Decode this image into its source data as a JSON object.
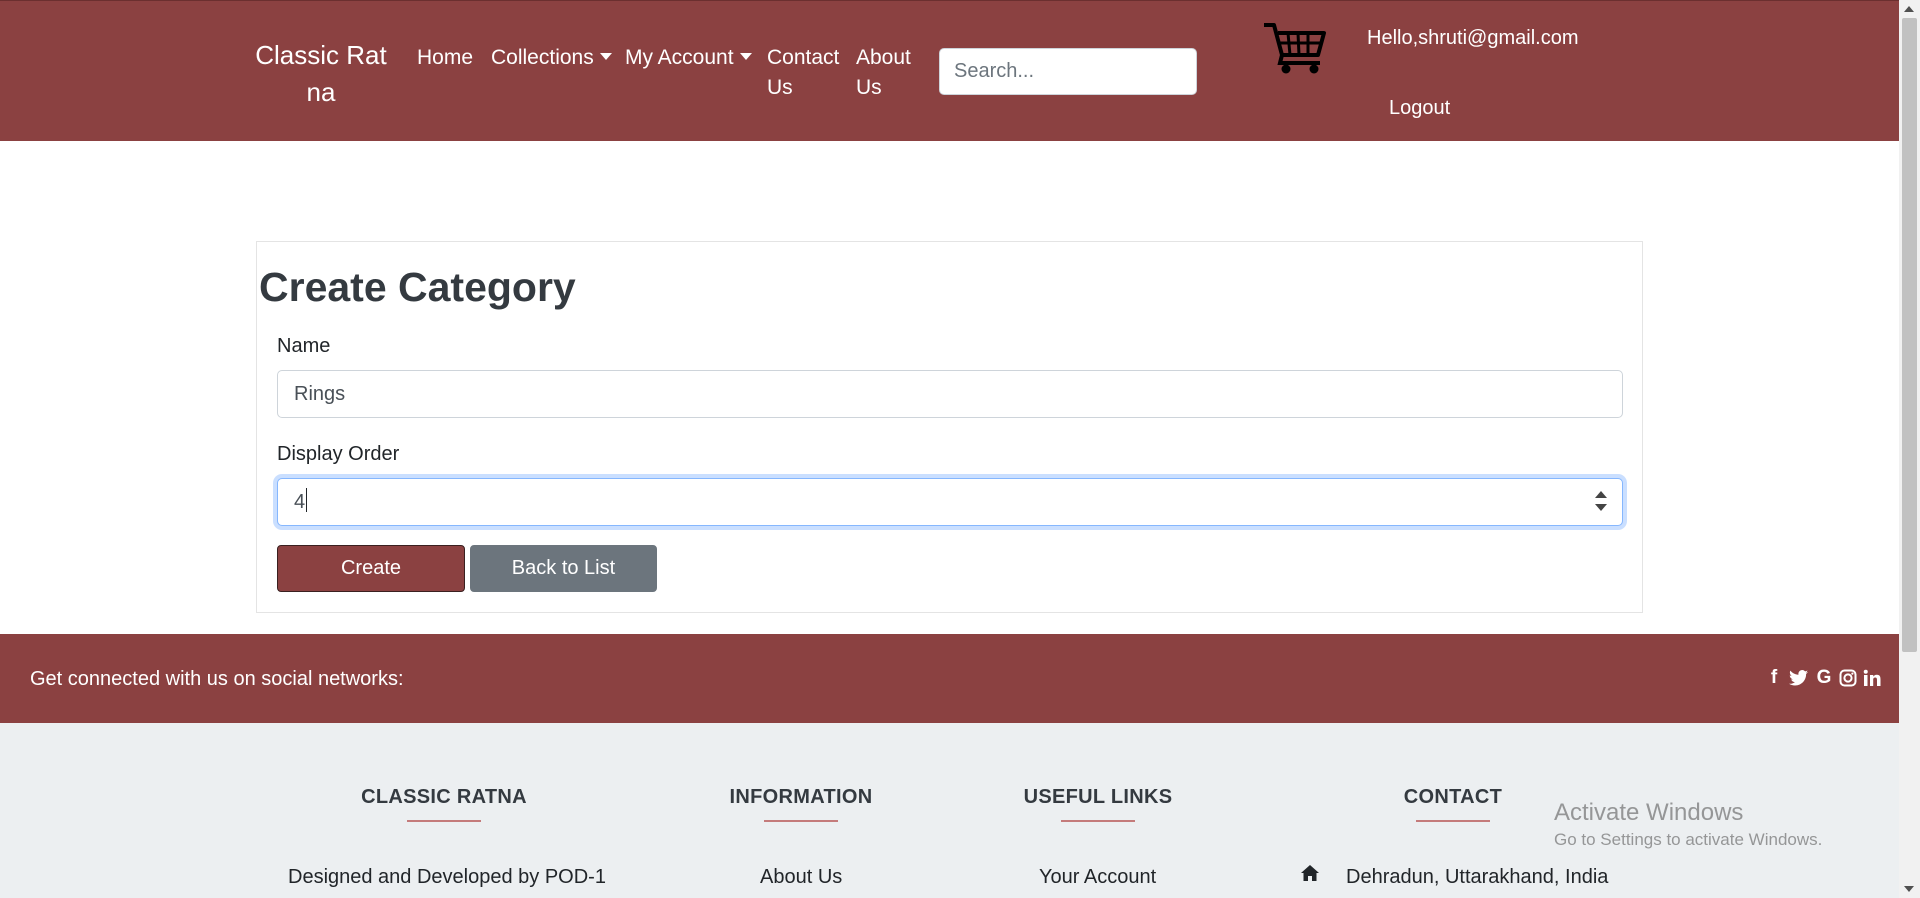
{
  "nav": {
    "brand": "Classic Ratna",
    "links": {
      "home": "Home",
      "collections": "Collections",
      "my_account": "My Account",
      "contact_us": "Contact Us",
      "about_us": "About Us"
    },
    "search_placeholder": "Search...",
    "cart_icon": "shopping-cart-icon",
    "greeting": "Hello,shruti@gmail.com",
    "logout": "Logout"
  },
  "form": {
    "title": "Create Category",
    "name_label": "Name",
    "name_value": "Rings",
    "display_order_label": "Display Order",
    "display_order_value": "4",
    "create_button": "Create",
    "back_button": "Back to List"
  },
  "social": {
    "text": "Get connected with us on social networks:",
    "icons": [
      "facebook-icon",
      "twitter-icon",
      "google-icon",
      "instagram-icon",
      "linkedin-icon"
    ]
  },
  "footer": {
    "columns": [
      {
        "heading": "CLASSIC RATNA",
        "text": "Designed and Developed by POD-1"
      },
      {
        "heading": "INFORMATION",
        "text": "About Us"
      },
      {
        "heading": "USEFUL LINKS",
        "text": "Your Account"
      },
      {
        "heading": "CONTACT",
        "text": "Dehradun, Uttarakhand, India"
      }
    ],
    "contact_icon": "home-icon"
  },
  "watermark": {
    "title": "Activate Windows",
    "subtitle": "Go to Settings to activate Windows."
  },
  "colors": {
    "brand": "#8b4141",
    "secondary": "#6c757d",
    "footer_bg": "#eceff1"
  }
}
